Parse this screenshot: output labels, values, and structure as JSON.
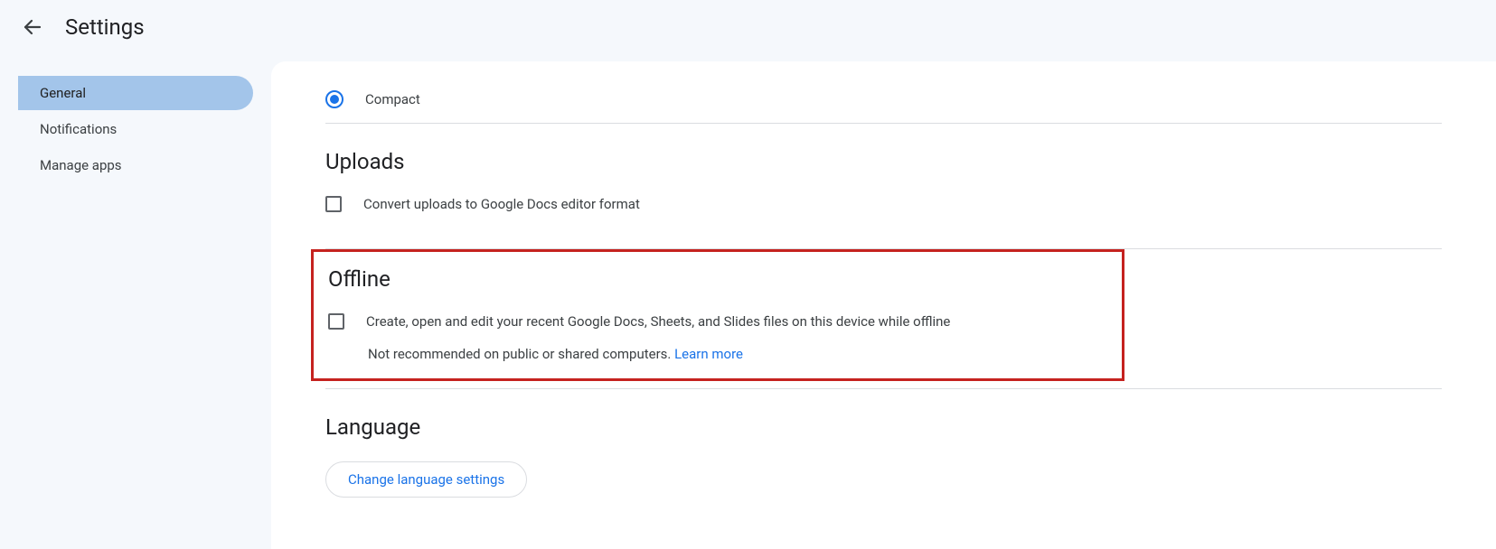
{
  "header": {
    "title": "Settings"
  },
  "sidebar": {
    "items": [
      {
        "label": "General",
        "active": true
      },
      {
        "label": "Notifications",
        "active": false
      },
      {
        "label": "Manage apps",
        "active": false
      }
    ]
  },
  "main": {
    "compact": {
      "label": "Compact"
    },
    "uploads": {
      "title": "Uploads",
      "convert_label": "Convert uploads to Google Docs editor format"
    },
    "offline": {
      "title": "Offline",
      "main_label": "Create, open and edit your recent Google Docs, Sheets, and Slides files on this device while offline",
      "subtext": "Not recommended on public or shared computers. ",
      "learn_more": "Learn more"
    },
    "language": {
      "title": "Language",
      "button_label": "Change language settings"
    }
  }
}
